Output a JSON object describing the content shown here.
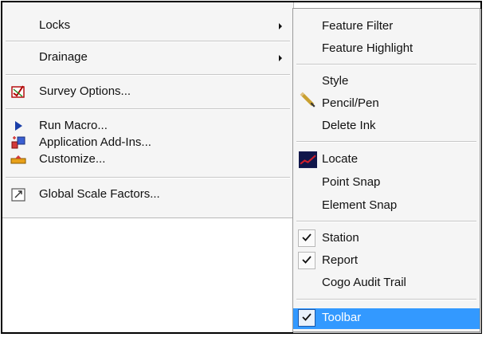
{
  "left_menu": {
    "locks": "Locks",
    "drainage": "Drainage",
    "survey_options": "Survey Options...",
    "run_macro": "Run Macro...",
    "application_add_ins": "Application Add-Ins...",
    "customize": "Customize...",
    "global_scale_factors": "Global Scale Factors..."
  },
  "right_menu": {
    "feature_filter": "Feature Filter",
    "feature_highlight": "Feature Highlight",
    "style": "Style",
    "pencil_pen": "Pencil/Pen",
    "delete_ink": "Delete Ink",
    "locate": "Locate",
    "point_snap": "Point Snap",
    "element_snap": "Element Snap",
    "station": "Station",
    "report": "Report",
    "cogo_audit_trail": "Cogo Audit Trail",
    "toolbar": "Toolbar"
  },
  "checked": {
    "station": true,
    "report": true,
    "toolbar": true
  },
  "colors": {
    "highlight": "#3399ff",
    "menu_background": "#f5f5f5"
  }
}
